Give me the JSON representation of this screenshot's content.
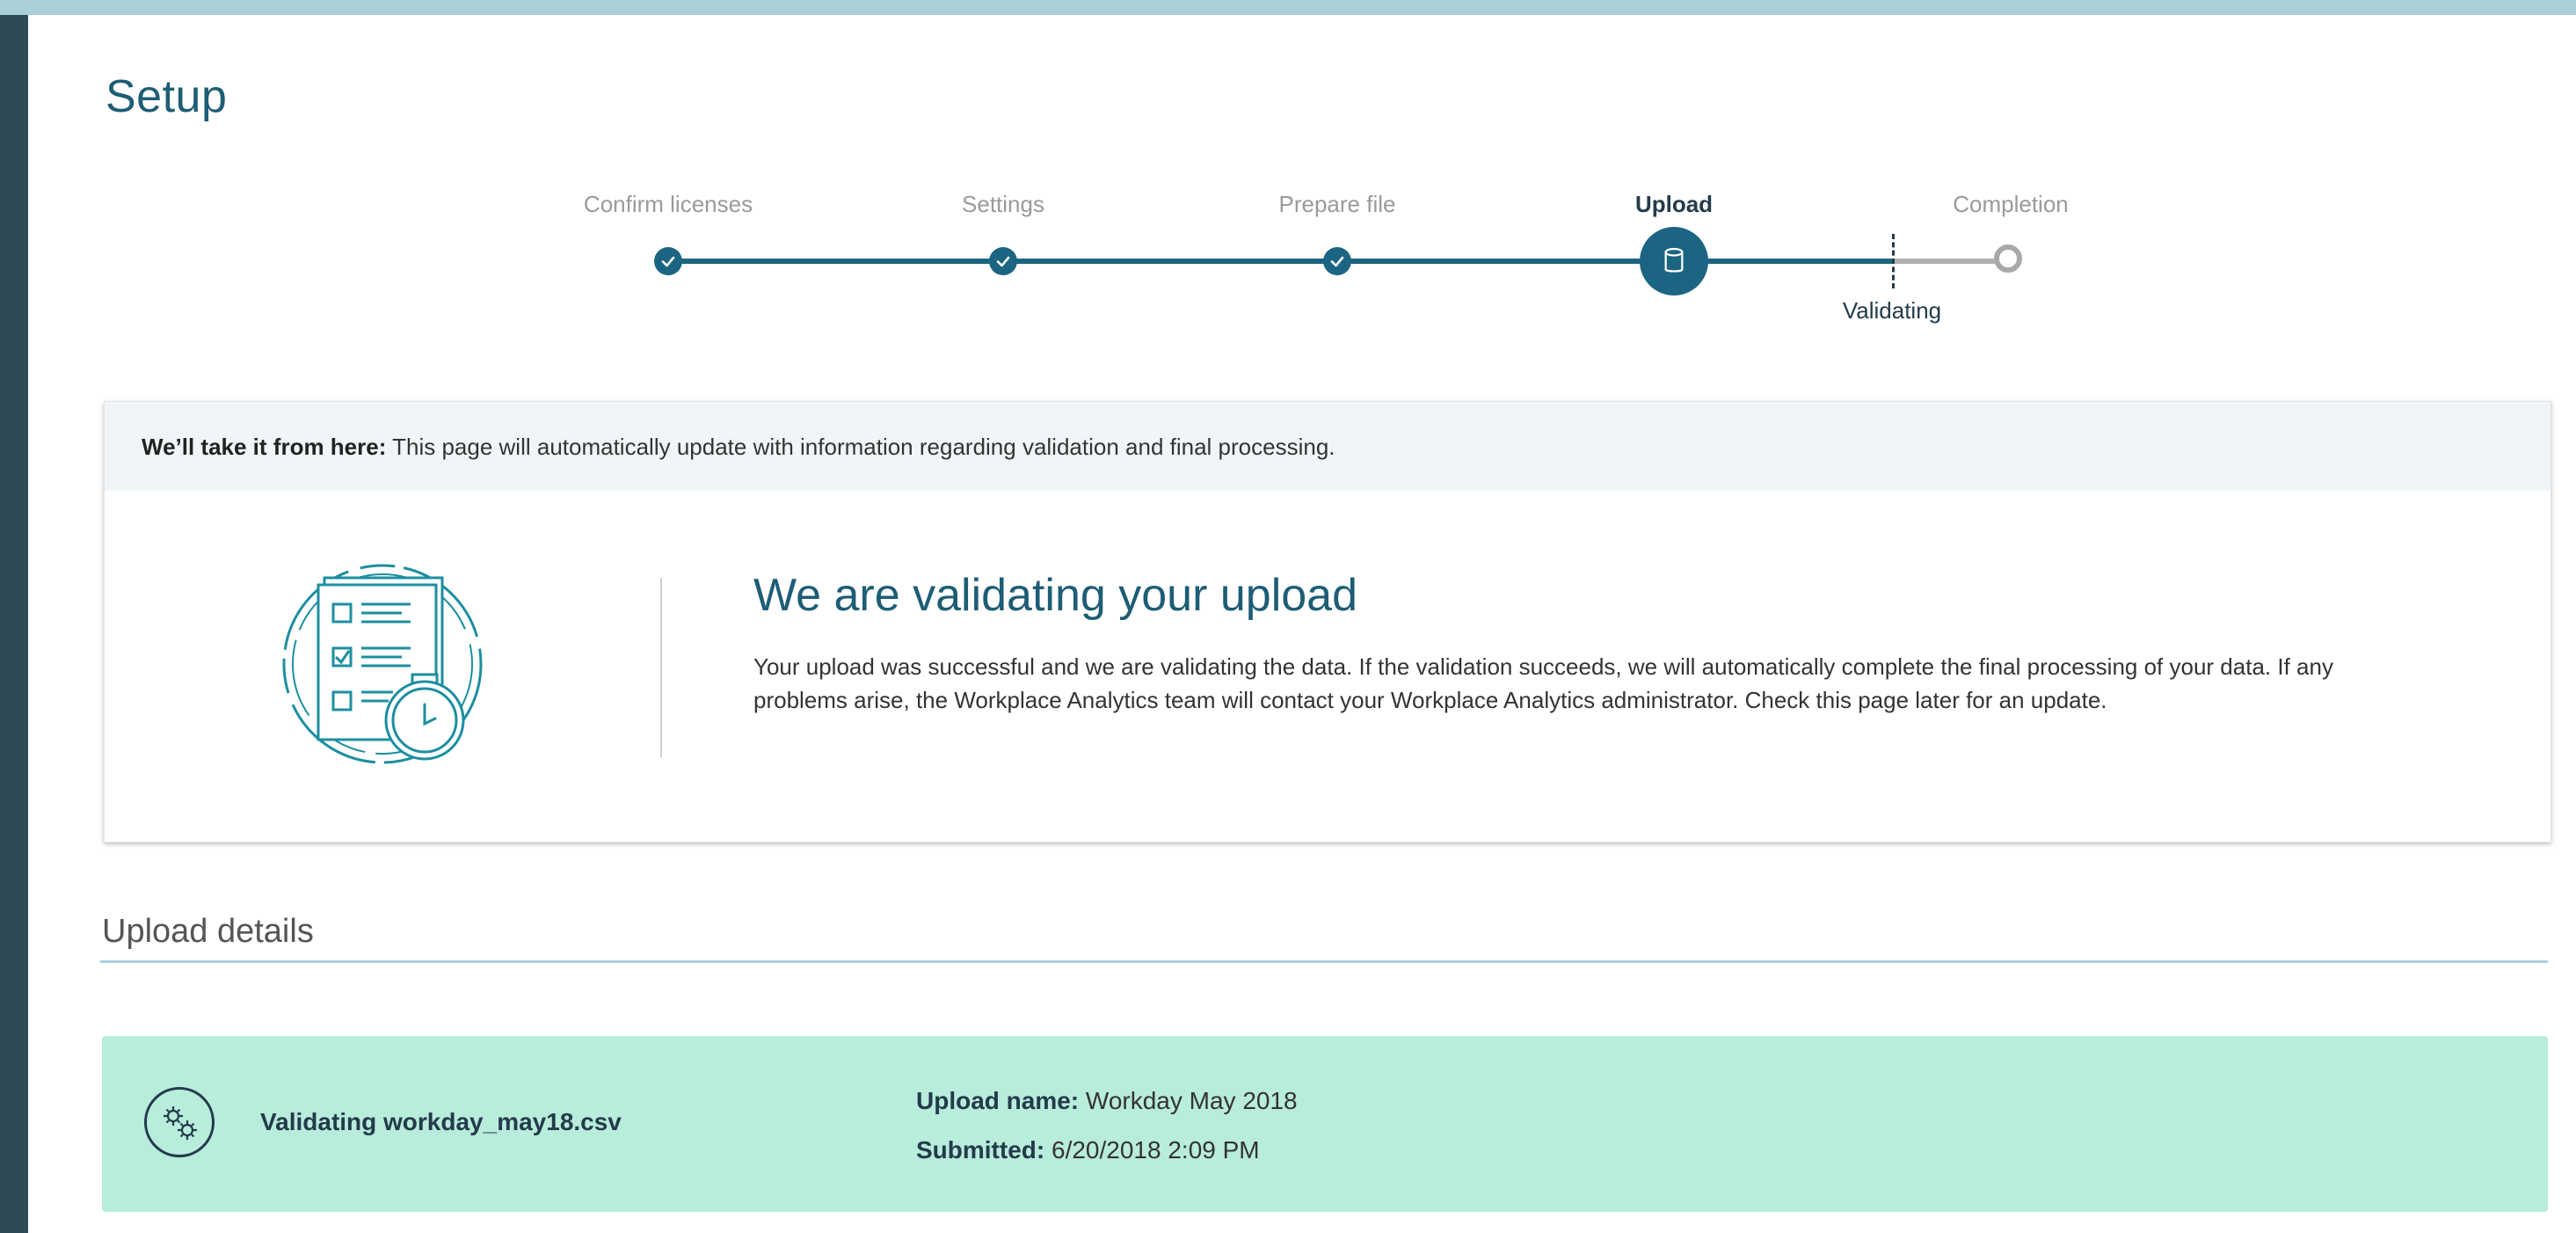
{
  "page": {
    "title": "Setup"
  },
  "stepper": {
    "steps": [
      {
        "label": "Confirm licenses",
        "state": "done"
      },
      {
        "label": "Settings",
        "state": "done"
      },
      {
        "label": "Prepare file",
        "state": "done"
      },
      {
        "label": "Upload",
        "state": "current",
        "icon": "database-icon"
      },
      {
        "label": "Completion",
        "state": "pending"
      }
    ],
    "substep_label": "Validating"
  },
  "info_card": {
    "head_bold": "We’ll take it from here:",
    "head_text": " This page will automatically update with information regarding validation and final processing.",
    "title": "We are validating your upload",
    "body": "Your upload was successful and we are validating the data. If the validation succeeds, we will automatically complete the final processing of your data. If any problems arise, the Workplace Analytics team will contact your Workplace Analytics administrator. Check this page later for an update.",
    "illustration": "checklist-stopwatch-icon"
  },
  "upload_details": {
    "section_title": "Upload details",
    "status_icon": "gears-icon",
    "status_text": "Validating workday_may18.csv",
    "upload_name_label": "Upload name:",
    "upload_name_value": " Workday May 2018",
    "submitted_label": "Submitted:",
    "submitted_value": " 6/20/2018 2:09 PM"
  },
  "colors": {
    "accent": "#1c6582",
    "title": "#1d5d75",
    "status_bg": "#b8ecdb",
    "sidebar": "#2f4a57",
    "topbar": "#a9d0d9"
  }
}
